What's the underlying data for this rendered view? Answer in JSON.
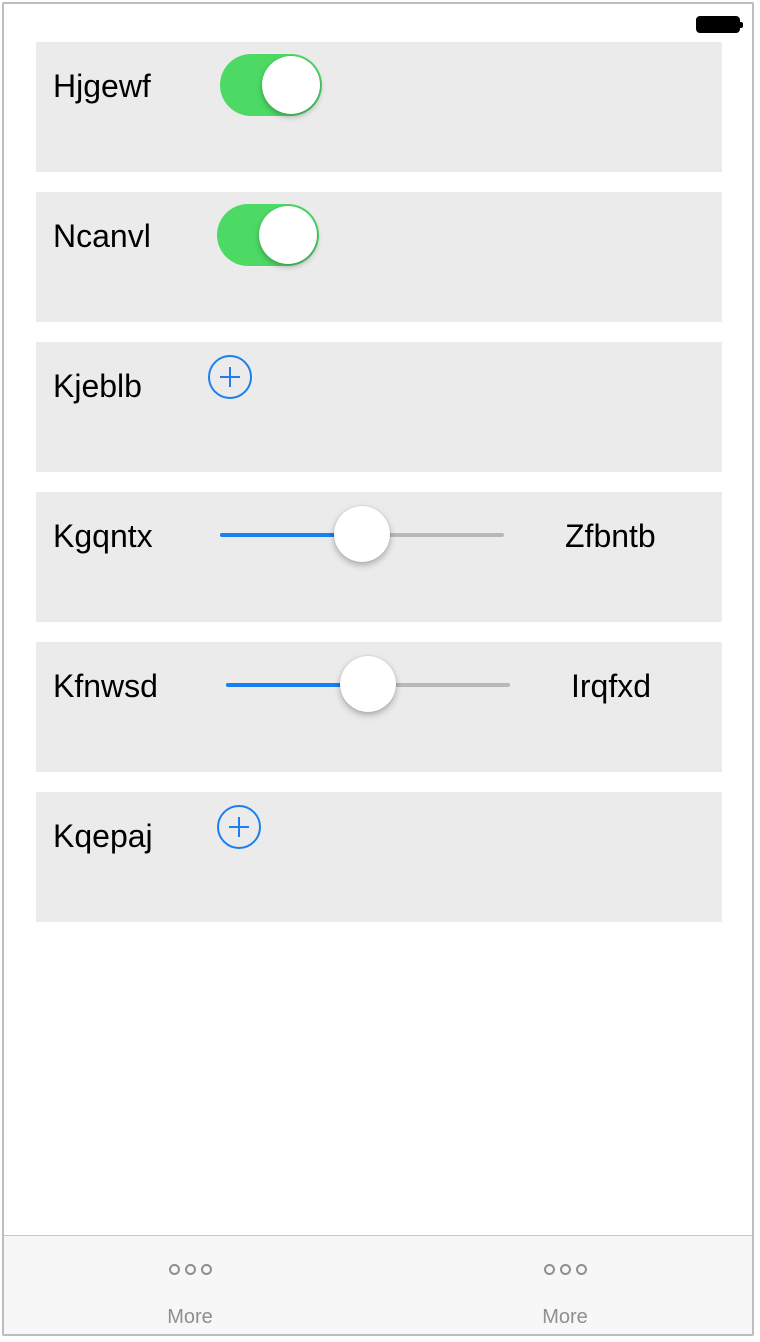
{
  "status_bar": {
    "battery_icon": "battery-full-icon"
  },
  "rows": [
    {
      "type": "toggle",
      "label": "Hjgewf",
      "on": true
    },
    {
      "type": "toggle",
      "label": "Ncanvl",
      "on": true
    },
    {
      "type": "add",
      "label": "Kjeblb",
      "icon": "plus-circle-icon"
    },
    {
      "type": "slider",
      "label": "Kgqntx",
      "value_label": "Zfbntb",
      "fraction": 0.5
    },
    {
      "type": "slider",
      "label": "Kfnwsd",
      "value_label": "Irqfxd",
      "fraction": 0.5
    },
    {
      "type": "add",
      "label": "Kqepaj",
      "icon": "plus-circle-icon"
    }
  ],
  "tabbar": {
    "tabs": [
      {
        "label": "More",
        "icon": "more-icon"
      },
      {
        "label": "More",
        "icon": "more-icon"
      }
    ]
  },
  "colors": {
    "toggle_on": "#4cd964",
    "accent": "#1a7ff0",
    "card_bg": "#ebebeb",
    "tab_gray": "#8e8e93"
  }
}
